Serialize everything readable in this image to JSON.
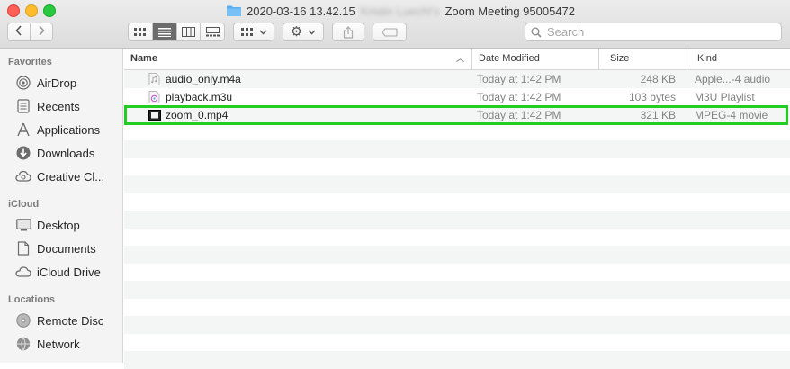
{
  "window": {
    "title_prefix": "2020-03-16 13.42.15",
    "title_blurred": "Kristin Luecht's",
    "title_suffix": "Zoom Meeting 95005472"
  },
  "toolbar": {
    "back_icon": "chevron-left-icon",
    "forward_icon": "chevron-right-icon",
    "view_modes": [
      "icon-view",
      "list-view",
      "column-view",
      "gallery-view"
    ],
    "active_view": "list-view",
    "search_placeholder": "Search"
  },
  "sidebar": {
    "sections": [
      {
        "label": "Favorites",
        "items": [
          {
            "label": "AirDrop",
            "icon": "airdrop-icon"
          },
          {
            "label": "Recents",
            "icon": "recents-icon"
          },
          {
            "label": "Applications",
            "icon": "applications-icon"
          },
          {
            "label": "Downloads",
            "icon": "downloads-icon"
          },
          {
            "label": "Creative Cl...",
            "icon": "creative-cloud-icon"
          }
        ]
      },
      {
        "label": "iCloud",
        "items": [
          {
            "label": "Desktop",
            "icon": "desktop-icon"
          },
          {
            "label": "Documents",
            "icon": "documents-icon"
          },
          {
            "label": "iCloud Drive",
            "icon": "icloud-icon"
          }
        ]
      },
      {
        "label": "Locations",
        "items": [
          {
            "label": "Remote Disc",
            "icon": "disc-icon"
          },
          {
            "label": "Network",
            "icon": "network-icon"
          }
        ]
      }
    ]
  },
  "file_list": {
    "columns": {
      "name": "Name",
      "date": "Date Modified",
      "size": "Size",
      "kind": "Kind"
    },
    "files": [
      {
        "name": "audio_only.m4a",
        "date": "Today at 1:42 PM",
        "size": "248 KB",
        "kind": "Apple...-4 audio",
        "icon": "audio-file-icon"
      },
      {
        "name": "playback.m3u",
        "date": "Today at 1:42 PM",
        "size": "103 bytes",
        "kind": "M3U Playlist",
        "icon": "playlist-file-icon"
      },
      {
        "name": "zoom_0.mp4",
        "date": "Today at 1:42 PM",
        "size": "321 KB",
        "kind": "MPEG-4 movie",
        "icon": "video-file-icon",
        "highlighted": true
      }
    ]
  },
  "colors": {
    "highlight": "#22cc22",
    "folder": "#5aaef0"
  }
}
